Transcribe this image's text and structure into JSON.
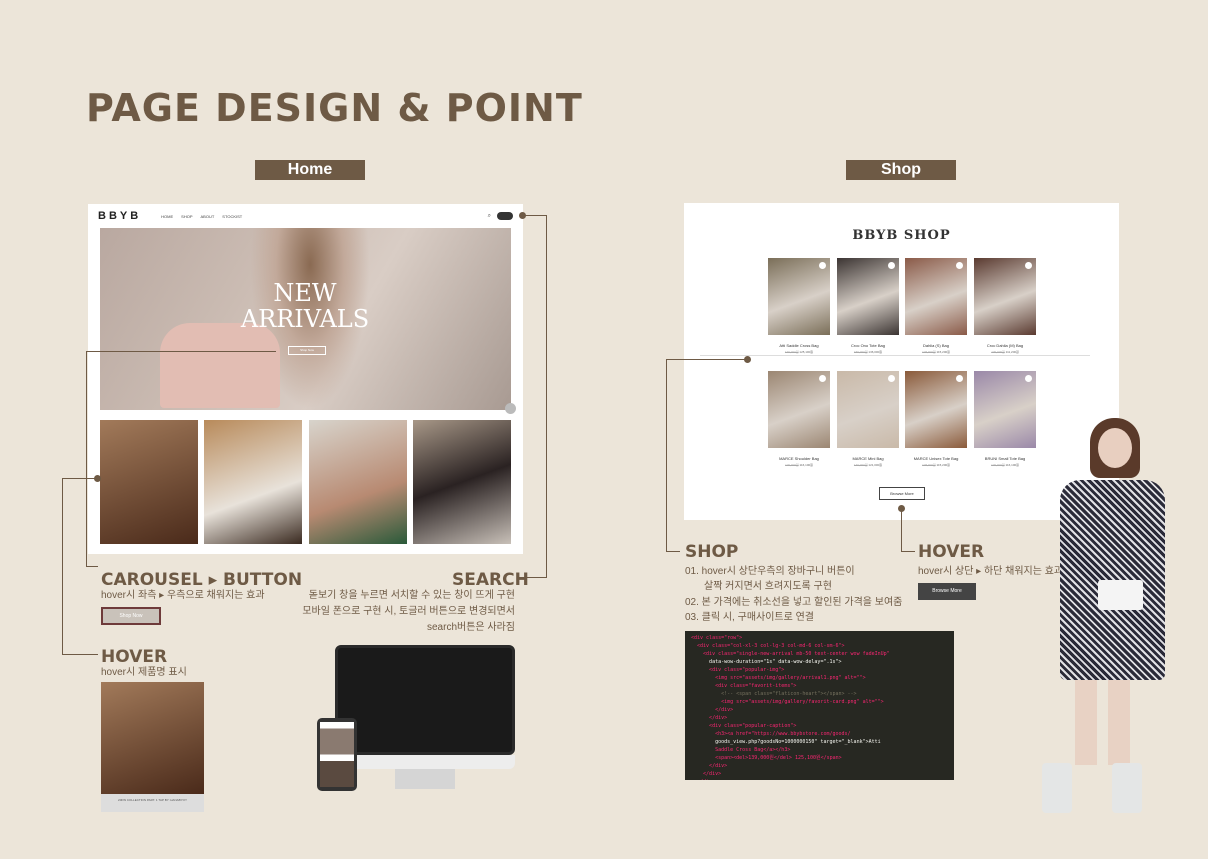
{
  "page_title": "PAGE DESIGN & POINT",
  "tags": {
    "home": "Home",
    "shop": "Shop"
  },
  "home": {
    "logo": "BBYB",
    "nav": [
      "HOME",
      "SHOP",
      "ABOUT",
      "STOCKIST"
    ],
    "hero_title": "NEW ARRIVALS",
    "hero_button": "Shop Now"
  },
  "sections": {
    "carousel": {
      "title": "CAROUSEL ▸ BUTTON",
      "desc": "hover시 좌측 ▸ 우측으로 채워지는 효과",
      "button": "Shop Now"
    },
    "search": {
      "title": "SEARCH",
      "desc": [
        "돋보기 창을 누르면 서치할 수 있는 창이 뜨게 구현",
        "모바일 폰으로 구현 시, 토글러 버튼으로 변경되면서",
        "search버튼은 사라짐"
      ]
    },
    "hover_home": {
      "title": "HOVER",
      "desc": "hover시 제품명 표시",
      "caption": "20FW COLLECTION PART. 1 TAP BY: HANABYOY"
    },
    "shop": {
      "title": "SHOP",
      "desc": [
        "01. hover시 상단우측의 장바구니 버튼이",
        "살짝 커지면서 흐려지도록 구현",
        "02. 본 가격에는 취소선을 넣고 할인된 가격을 보여줌",
        "03. 클릭 시, 구매사이트로 연결"
      ]
    },
    "hover_shop": {
      "title": "HOVER",
      "desc": "hover시 상단 ▸ 하단 채워지는 효과",
      "button": "Browse More"
    }
  },
  "shop": {
    "title": "BBYB SHOP",
    "products": [
      {
        "name": "Atti Saddle Cross Bag",
        "old": "139,000원",
        "price": "125,100원",
        "color": "#7a6e58"
      },
      {
        "name": "Croc Ono Tote Bag",
        "old": "159,000원",
        "price": "136,000원",
        "color": "#3b3432"
      },
      {
        "name": "Dahlia (S) Bag",
        "old": "128,000원",
        "price": "115,200원",
        "color": "#8a5a48"
      },
      {
        "name": "Croc Dahlia (M) Bag",
        "old": "139,000원",
        "price": "111,200원",
        "color": "#5a3a30"
      },
      {
        "name": "MARCE Shoulder Bag",
        "old": "129,000원",
        "price": "116,100원",
        "color": "#9b8672"
      },
      {
        "name": "MARCE Mini Bag",
        "old": "149,000원",
        "price": "121,000원",
        "color": "#c9b9a8"
      },
      {
        "name": "MARCE Unisex Tote Bag",
        "old": "128,000원",
        "price": "115,200원",
        "color": "#8a5a3a"
      },
      {
        "name": "BRUNI Small Tote Bag",
        "old": "129,000원",
        "price": "116,100원",
        "color": "#9a88a8"
      }
    ],
    "browse": "Browse More"
  },
  "code_lines": [
    "<div class=\"row\">",
    "  <div class=\"col-xl-3 col-lg-3 col-md-6 col-sm-6\">",
    "    <div class=\"single-new-arrival mb-50 text-center wow fadeInUp\"",
    "      data-wow-duration=\"1s\" data-wow-delay=\".1s\">",
    "      <div class=\"popular-img\">",
    "        <img src=\"assets/img/gallery/arrival1.png\" alt=\"\">",
    "        <div class=\"favorit-items\">",
    "          <!-- <span class=\"flaticon-heart\"></span> -->",
    "          <img src=\"assets/img/gallery/favorit-card.png\" alt=\"\">",
    "        </div>",
    "      </div>",
    "      <div class=\"popular-caption\">",
    "        <h3><a href=\"https://www.bbybstore.com/goods/",
    "        goods_view.php?goodsNo=1000000150\" target=\"_blank\">Atti",
    "        Saddle Cross Bag</a></h3>",
    "        <span><del>139,000원</del> 125,100원</span>",
    "      </div>",
    "    </div>",
    "  </div>"
  ],
  "colors": {
    "accent": "#6e5a45",
    "background": "#ece5d9"
  }
}
